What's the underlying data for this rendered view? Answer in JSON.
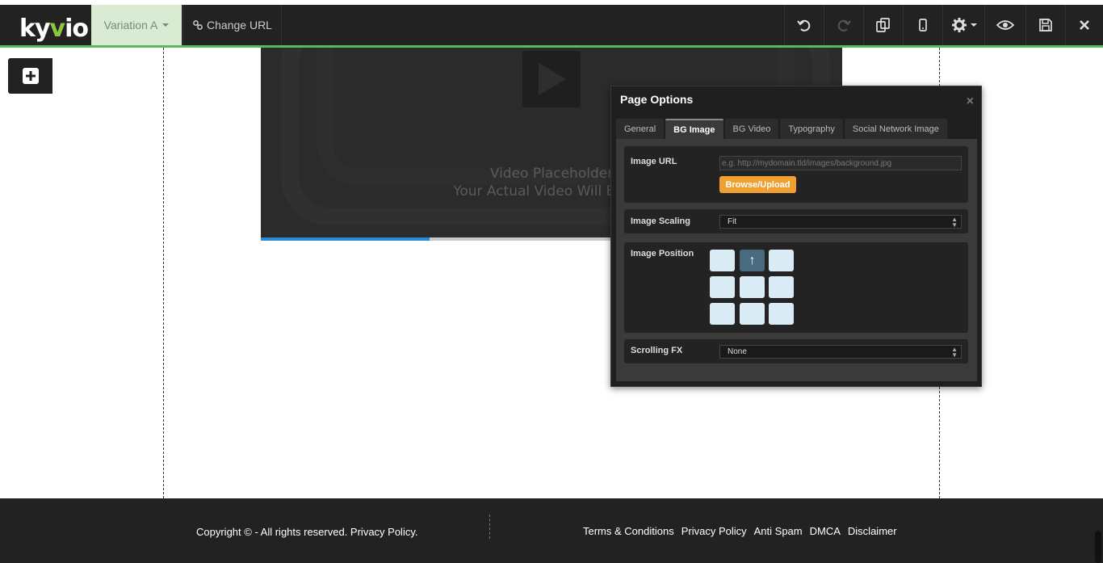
{
  "topbar": {
    "logo_left": "ky",
    "logo_v": "v",
    "logo_right": "io",
    "variation_label": "Variation A",
    "change_url_label": "Change URL",
    "icons": [
      "undo-icon",
      "redo-icon",
      "duplicate-icon",
      "mobile-icon",
      "gear-icon",
      "preview-icon",
      "save-icon",
      "close-icon"
    ],
    "accent": "#5cb85c",
    "variation_bg": "#d9ecd3"
  },
  "video": {
    "line1": "Video Placeholder",
    "line2": "Your Actual Video Will Be Dis",
    "progress_fraction": 0.29,
    "progress_color": "#2a8ad4"
  },
  "panel": {
    "title": "Page Options",
    "close_symbol": "×",
    "tabs": [
      {
        "label": "General",
        "active": false
      },
      {
        "label": "BG Image",
        "active": true
      },
      {
        "label": "BG Video",
        "active": false
      },
      {
        "label": "Typography",
        "active": false
      },
      {
        "label": "Social Network Image",
        "active": false
      }
    ],
    "image_url": {
      "label": "Image URL",
      "placeholder": "e.g. http://mydomain.tld/images/background.jpg",
      "value": "",
      "browse_label": "Browse/Upload",
      "browse_color": "#f0a030"
    },
    "image_scaling": {
      "label": "Image Scaling",
      "selected": "Fit"
    },
    "image_position": {
      "label": "Image Position",
      "selected": "top-center",
      "selected_glyph": "↑"
    },
    "scrolling_fx": {
      "label": "Scrolling FX",
      "selected": "None"
    }
  },
  "footer": {
    "copyright": "Copyright © - All rights reserved. Privacy Policy.",
    "links": [
      "Terms & Conditions",
      "Privacy Policy",
      "Anti Spam",
      "DMCA",
      "Disclaimer"
    ]
  }
}
